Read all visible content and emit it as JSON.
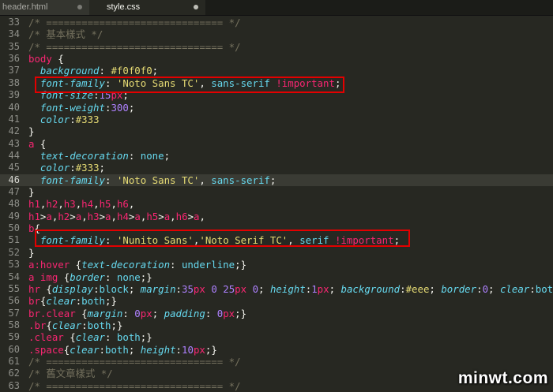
{
  "tabs": [
    {
      "label": "header.html",
      "active": false
    },
    {
      "label": "style.css",
      "active": true
    }
  ],
  "lines": [
    {
      "n": "33",
      "t": [
        [
          "c",
          "/* ============================== */"
        ]
      ]
    },
    {
      "n": "34",
      "t": [
        [
          "c",
          "/* 基本樣式 */"
        ]
      ]
    },
    {
      "n": "35",
      "t": [
        [
          "c",
          "/* ============================== */"
        ]
      ]
    },
    {
      "n": "36",
      "t": [
        [
          "sel",
          "body"
        ],
        [
          "p",
          " {"
        ]
      ]
    },
    {
      "n": "37",
      "t": [
        [
          "p",
          "  "
        ],
        [
          "prop",
          "background"
        ],
        [
          "p",
          ": "
        ],
        [
          "s",
          "#f0f0f0"
        ],
        [
          "p",
          ";"
        ]
      ]
    },
    {
      "n": "38",
      "t": [
        [
          "p",
          "  "
        ],
        [
          "prop",
          "font-family"
        ],
        [
          "p",
          ": "
        ],
        [
          "s",
          "'Noto Sans TC'"
        ],
        [
          "p",
          ", "
        ],
        [
          "v",
          "sans-serif"
        ],
        [
          "p",
          " "
        ],
        [
          "k",
          "!important"
        ],
        [
          "p",
          ";"
        ]
      ]
    },
    {
      "n": "39",
      "t": [
        [
          "p",
          "  "
        ],
        [
          "prop",
          "font-size"
        ],
        [
          "p",
          ":"
        ],
        [
          "n",
          "15"
        ],
        [
          "u",
          "px"
        ],
        [
          "p",
          ";"
        ]
      ]
    },
    {
      "n": "40",
      "t": [
        [
          "p",
          "  "
        ],
        [
          "prop",
          "font-weight"
        ],
        [
          "p",
          ":"
        ],
        [
          "n",
          "300"
        ],
        [
          "p",
          ";"
        ]
      ]
    },
    {
      "n": "41",
      "t": [
        [
          "p",
          "  "
        ],
        [
          "prop",
          "color"
        ],
        [
          "p",
          ":"
        ],
        [
          "s",
          "#333"
        ]
      ]
    },
    {
      "n": "42",
      "t": [
        [
          "p",
          "}"
        ]
      ]
    },
    {
      "n": "43",
      "t": [
        [
          "sel",
          "a"
        ],
        [
          "p",
          " {"
        ]
      ]
    },
    {
      "n": "44",
      "t": [
        [
          "p",
          "  "
        ],
        [
          "prop",
          "text-decoration"
        ],
        [
          "p",
          ": "
        ],
        [
          "v",
          "none"
        ],
        [
          "p",
          ";"
        ]
      ]
    },
    {
      "n": "45",
      "t": [
        [
          "p",
          "  "
        ],
        [
          "prop",
          "color"
        ],
        [
          "p",
          ":"
        ],
        [
          "s",
          "#333"
        ],
        [
          "p",
          ";"
        ]
      ]
    },
    {
      "n": "46",
      "t": [
        [
          "p",
          "  "
        ],
        [
          "prop",
          "font-family"
        ],
        [
          "p",
          ": "
        ],
        [
          "s",
          "'Noto Sans TC'"
        ],
        [
          "p",
          ", "
        ],
        [
          "v",
          "sans-serif"
        ],
        [
          "p",
          ";"
        ]
      ],
      "current": true
    },
    {
      "n": "47",
      "t": [
        [
          "p",
          "}"
        ]
      ]
    },
    {
      "n": "48",
      "t": [
        [
          "sel",
          "h1"
        ],
        [
          "p",
          ","
        ],
        [
          "sel",
          "h2"
        ],
        [
          "p",
          ","
        ],
        [
          "sel",
          "h3"
        ],
        [
          "p",
          ","
        ],
        [
          "sel",
          "h4"
        ],
        [
          "p",
          ","
        ],
        [
          "sel",
          "h5"
        ],
        [
          "p",
          ","
        ],
        [
          "sel",
          "h6"
        ],
        [
          "p",
          ","
        ]
      ]
    },
    {
      "n": "49",
      "t": [
        [
          "sel",
          "h1"
        ],
        [
          "p",
          ">"
        ],
        [
          "sel",
          "a"
        ],
        [
          "p",
          ","
        ],
        [
          "sel",
          "h2"
        ],
        [
          "p",
          ">"
        ],
        [
          "sel",
          "a"
        ],
        [
          "p",
          ","
        ],
        [
          "sel",
          "h3"
        ],
        [
          "p",
          ">"
        ],
        [
          "sel",
          "a"
        ],
        [
          "p",
          ","
        ],
        [
          "sel",
          "h4"
        ],
        [
          "p",
          ">"
        ],
        [
          "sel",
          "a"
        ],
        [
          "p",
          ","
        ],
        [
          "sel",
          "h5"
        ],
        [
          "p",
          ">"
        ],
        [
          "sel",
          "a"
        ],
        [
          "p",
          ","
        ],
        [
          "sel",
          "h6"
        ],
        [
          "p",
          ">"
        ],
        [
          "sel",
          "a"
        ],
        [
          "p",
          ","
        ]
      ]
    },
    {
      "n": "50",
      "t": [
        [
          "sel",
          "b"
        ],
        [
          "p",
          "{"
        ]
      ]
    },
    {
      "n": "51",
      "t": [
        [
          "p",
          "  "
        ],
        [
          "prop",
          "font-family"
        ],
        [
          "p",
          ": "
        ],
        [
          "s",
          "'Nunito Sans'"
        ],
        [
          "p",
          ","
        ],
        [
          "s",
          "'Noto Serif TC'"
        ],
        [
          "p",
          ", "
        ],
        [
          "v",
          "serif"
        ],
        [
          "p",
          " "
        ],
        [
          "k",
          "!important"
        ],
        [
          "p",
          ";"
        ]
      ]
    },
    {
      "n": "52",
      "t": [
        [
          "p",
          "}"
        ]
      ]
    },
    {
      "n": "53",
      "t": [
        [
          "sel",
          "a:hover"
        ],
        [
          "p",
          " {"
        ],
        [
          "prop",
          "text-decoration"
        ],
        [
          "p",
          ": "
        ],
        [
          "v",
          "underline"
        ],
        [
          "p",
          ";}"
        ]
      ]
    },
    {
      "n": "54",
      "t": [
        [
          "sel",
          "a img"
        ],
        [
          "p",
          " {"
        ],
        [
          "prop",
          "border"
        ],
        [
          "p",
          ": "
        ],
        [
          "v",
          "none"
        ],
        [
          "p",
          ";}"
        ]
      ]
    },
    {
      "n": "55",
      "t": [
        [
          "sel",
          "hr"
        ],
        [
          "p",
          " {"
        ],
        [
          "prop",
          "display"
        ],
        [
          "p",
          ":"
        ],
        [
          "v",
          "block"
        ],
        [
          "p",
          "; "
        ],
        [
          "prop",
          "margin"
        ],
        [
          "p",
          ":"
        ],
        [
          "n",
          "35"
        ],
        [
          "u",
          "px"
        ],
        [
          "p",
          " "
        ],
        [
          "n",
          "0"
        ],
        [
          "p",
          " "
        ],
        [
          "n",
          "25"
        ],
        [
          "u",
          "px"
        ],
        [
          "p",
          " "
        ],
        [
          "n",
          "0"
        ],
        [
          "p",
          "; "
        ],
        [
          "prop",
          "height"
        ],
        [
          "p",
          ":"
        ],
        [
          "n",
          "1"
        ],
        [
          "u",
          "px"
        ],
        [
          "p",
          "; "
        ],
        [
          "prop",
          "background"
        ],
        [
          "p",
          ":"
        ],
        [
          "s",
          "#eee"
        ],
        [
          "p",
          "; "
        ],
        [
          "prop",
          "border"
        ],
        [
          "p",
          ":"
        ],
        [
          "n",
          "0"
        ],
        [
          "p",
          "; "
        ],
        [
          "prop",
          "clear"
        ],
        [
          "p",
          ":"
        ],
        [
          "v",
          "bot"
        ]
      ]
    },
    {
      "n": "56",
      "t": [
        [
          "sel",
          "br"
        ],
        [
          "p",
          "{"
        ],
        [
          "prop",
          "clear"
        ],
        [
          "p",
          ":"
        ],
        [
          "v",
          "both"
        ],
        [
          "p",
          ";}"
        ]
      ]
    },
    {
      "n": "57",
      "t": [
        [
          "sel",
          "br.clear"
        ],
        [
          "p",
          " {"
        ],
        [
          "prop",
          "margin"
        ],
        [
          "p",
          ": "
        ],
        [
          "n",
          "0"
        ],
        [
          "u",
          "px"
        ],
        [
          "p",
          "; "
        ],
        [
          "prop",
          "padding"
        ],
        [
          "p",
          ": "
        ],
        [
          "n",
          "0"
        ],
        [
          "u",
          "px"
        ],
        [
          "p",
          ";}"
        ]
      ]
    },
    {
      "n": "58",
      "t": [
        [
          "sel",
          ".br"
        ],
        [
          "p",
          "{"
        ],
        [
          "prop",
          "clear"
        ],
        [
          "p",
          ":"
        ],
        [
          "v",
          "both"
        ],
        [
          "p",
          ";}"
        ]
      ]
    },
    {
      "n": "59",
      "t": [
        [
          "sel",
          ".clear"
        ],
        [
          "p",
          " {"
        ],
        [
          "prop",
          "clear"
        ],
        [
          "p",
          ": "
        ],
        [
          "v",
          "both"
        ],
        [
          "p",
          ";}"
        ]
      ]
    },
    {
      "n": "60",
      "t": [
        [
          "sel",
          ".space"
        ],
        [
          "p",
          "{"
        ],
        [
          "prop",
          "clear"
        ],
        [
          "p",
          ":"
        ],
        [
          "v",
          "both"
        ],
        [
          "p",
          "; "
        ],
        [
          "prop",
          "height"
        ],
        [
          "p",
          ":"
        ],
        [
          "n",
          "10"
        ],
        [
          "u",
          "px"
        ],
        [
          "p",
          ";}"
        ]
      ]
    },
    {
      "n": "61",
      "t": [
        [
          "c",
          "/* ============================== */"
        ]
      ]
    },
    {
      "n": "62",
      "t": [
        [
          "c",
          "/* 舊文章樣式 */"
        ]
      ]
    },
    {
      "n": "63",
      "t": [
        [
          "c",
          "/* ============================== */"
        ]
      ]
    }
  ],
  "highlights": [
    "38",
    "51"
  ],
  "highlight_color": "#e30000",
  "watermark": "minwt.com"
}
